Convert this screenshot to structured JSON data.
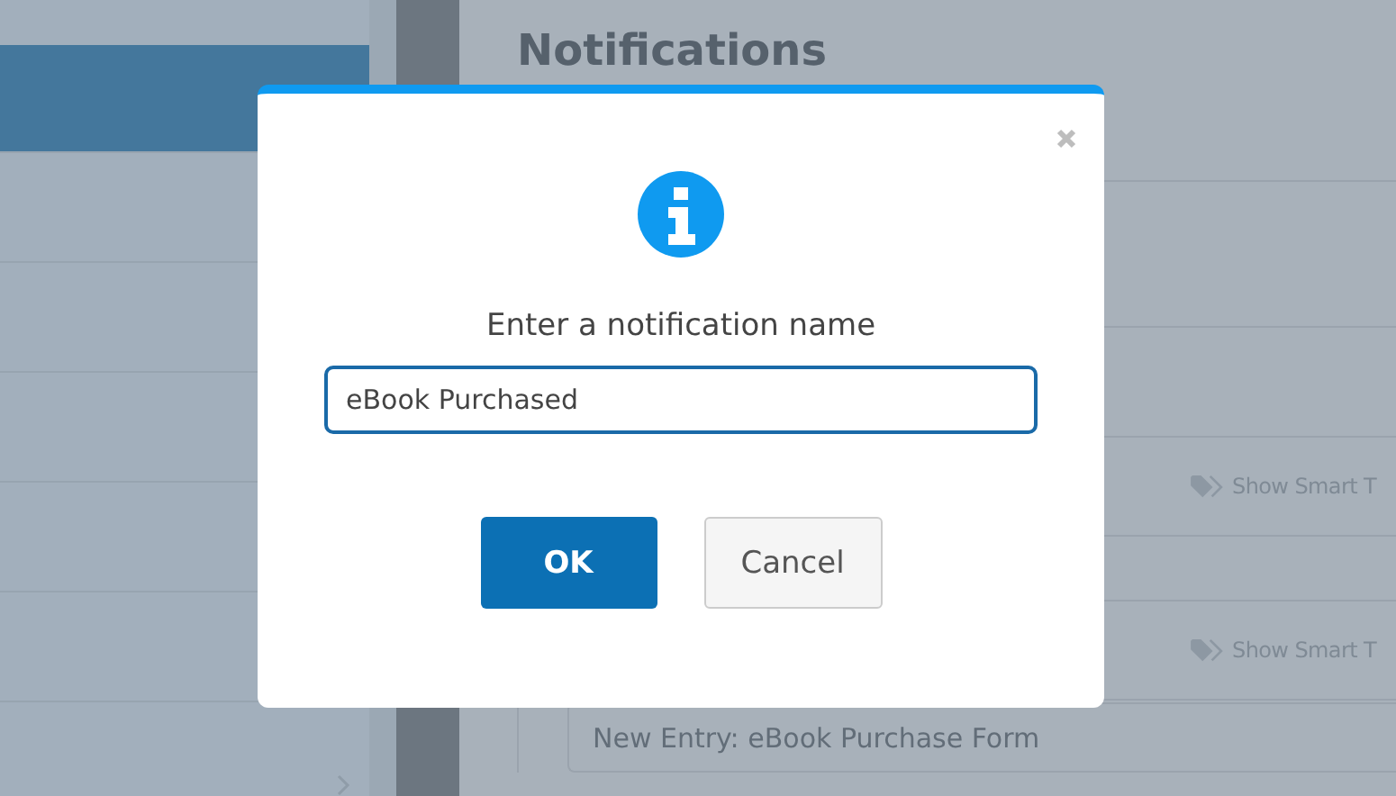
{
  "sidebar": {
    "items": [
      {
        "selected": true
      },
      {
        "selected": false
      },
      {
        "selected": false
      },
      {
        "selected": false
      },
      {
        "selected": false
      },
      {
        "selected": false
      },
      {
        "selected": false,
        "expandable": true
      }
    ]
  },
  "page": {
    "title": "Notifications",
    "smart_tags": [
      "Show Smart T",
      "Show Smart T"
    ],
    "subject_value": "New Entry: eBook Purchase Form"
  },
  "dialog": {
    "prompt": "Enter a notification name",
    "value": "eBook Purchased",
    "buttons": [
      {
        "label": "OK",
        "kind": "primary"
      },
      {
        "label": "Cancel",
        "kind": "secondary"
      }
    ]
  }
}
